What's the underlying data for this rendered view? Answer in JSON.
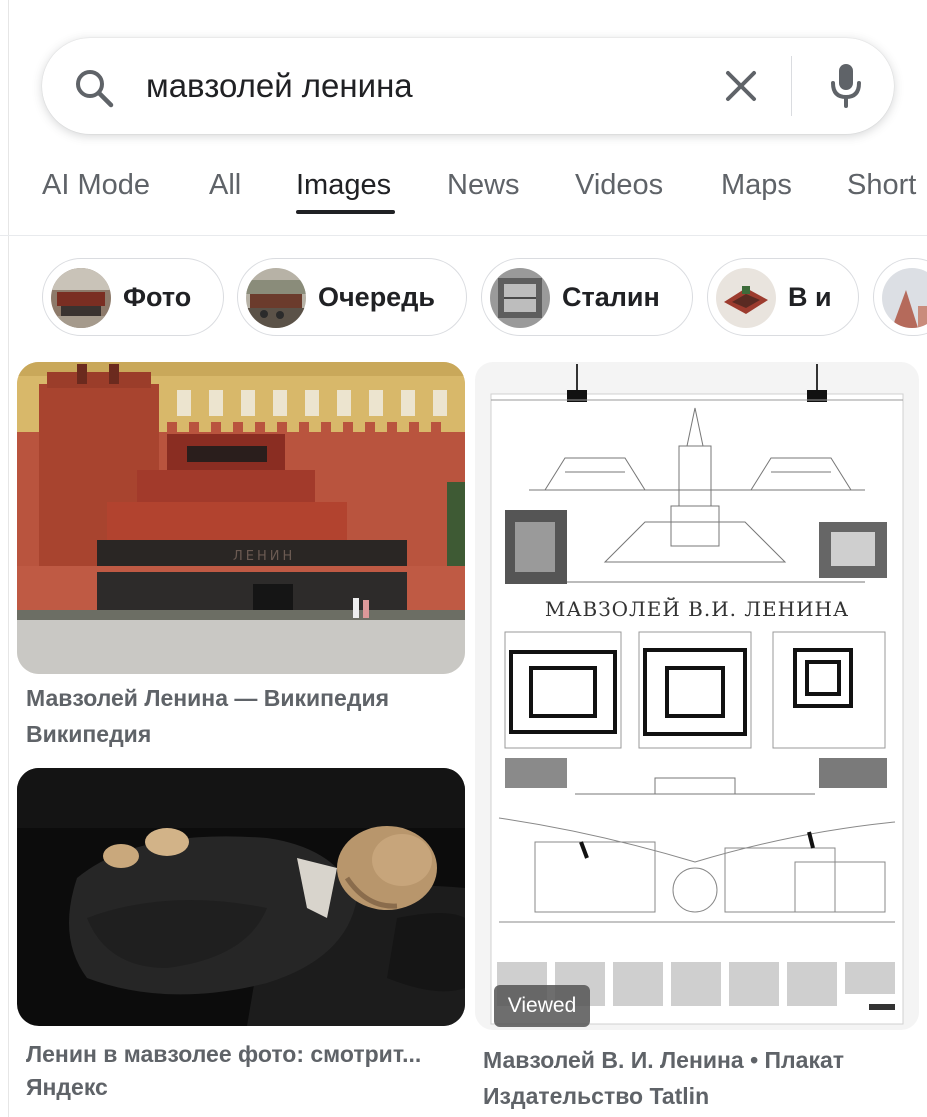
{
  "search": {
    "query": "мавзолей ленина",
    "icons": {
      "search": "search-icon",
      "clear": "close-icon",
      "voice": "mic-icon"
    }
  },
  "tabs": [
    {
      "label": "AI Mode",
      "active": false
    },
    {
      "label": "All",
      "active": false
    },
    {
      "label": "Images",
      "active": true
    },
    {
      "label": "News",
      "active": false
    },
    {
      "label": "Videos",
      "active": false
    },
    {
      "label": "Maps",
      "active": false
    },
    {
      "label": "Short",
      "active": false
    }
  ],
  "chips": [
    {
      "label": "Фото"
    },
    {
      "label": "Очередь"
    },
    {
      "label": "Сталин"
    },
    {
      "label": "В и"
    },
    {
      "label": ""
    }
  ],
  "results": [
    {
      "title": "Мавзолей Ленина — Википедия",
      "source": "Википедия",
      "image_text": "ЛЕНИН"
    },
    {
      "title": "Ленин в мавзолее фото: смотрит...",
      "source": "Яндекс"
    },
    {
      "title": "Мавзолей В. И. Ленина • Плакат",
      "source": "Издательство Tatlin",
      "image_text": "МАВЗОЛЕЙ В.И. ЛЕНИНА",
      "badge": "Viewed"
    }
  ],
  "colors": {
    "tab_active": "#202124",
    "tab_inactive": "#5f6368",
    "caption": "#5f6368",
    "chip_border": "#dadce0"
  }
}
